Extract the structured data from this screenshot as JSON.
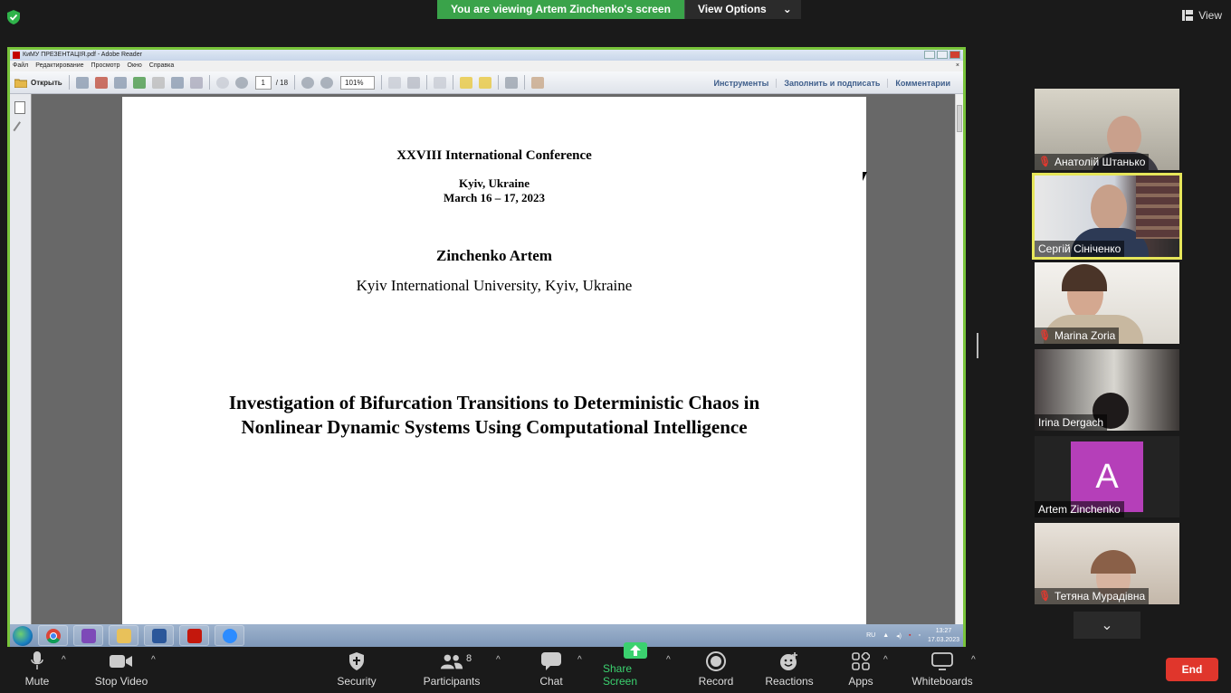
{
  "zoom_top": {
    "viewing_banner": "You are viewing Artem Zinchenko's screen",
    "view_options_label": "View Options",
    "view_label": "View"
  },
  "adobe": {
    "title": "КиМУ ПРЕЗЕНТАЦІЯ.pdf - Adobe Reader",
    "menu": [
      "Файл",
      "Редактирование",
      "Просмотр",
      "Окно",
      "Справка"
    ],
    "open_label": "Открыть",
    "page_current": "1",
    "page_total": "/ 18",
    "zoom_value": "101%",
    "right_tools": [
      "Инструменты",
      "Заполнить и подписать",
      "Комментарии"
    ]
  },
  "pdf": {
    "conference": "XXVIII International Conference",
    "city": "Kyiv, Ukraine",
    "dates": "March 16 – 17, 2023",
    "author": "Zinchenko Artem",
    "affiliation": "Kyiv International University, Kyiv, Ukraine",
    "title_line1": "Investigation of Bifurcation Transitions to Deterministic Chaos in",
    "title_line2": "Nonlinear Dynamic Systems Using Computational Intelligence"
  },
  "taskbar": {
    "lang": "RU",
    "time": "13:27",
    "date": "17.03.2023",
    "apps": [
      "chrome",
      "visual-studio",
      "file-explorer",
      "word",
      "adobe-reader",
      "zoom"
    ]
  },
  "participants": [
    {
      "name": "Анатолій Штанько",
      "muted": true
    },
    {
      "name": "Сергій Сініченко",
      "muted": false,
      "active": true
    },
    {
      "name": "Marina Zoria",
      "muted": true
    },
    {
      "name": "Irina Dergach",
      "muted": false
    },
    {
      "name": "Artem Zinchenko",
      "muted": false,
      "avatar_letter": "A"
    },
    {
      "name": "Тетяна Мурадівна",
      "muted": true
    }
  ],
  "controls": {
    "mute": "Mute",
    "stop_video": "Stop Video",
    "security": "Security",
    "participants": "Participants",
    "participants_count": "8",
    "chat": "Chat",
    "share_screen": "Share Screen",
    "record": "Record",
    "reactions": "Reactions",
    "apps": "Apps",
    "whiteboards": "Whiteboards",
    "end": "End"
  },
  "colors": {
    "zoom_green": "#3aa34a",
    "share_border": "#78c43a",
    "active_speaker": "#e6e65a",
    "end_red": "#e0362c",
    "avatar_purple": "#b53fb9"
  }
}
